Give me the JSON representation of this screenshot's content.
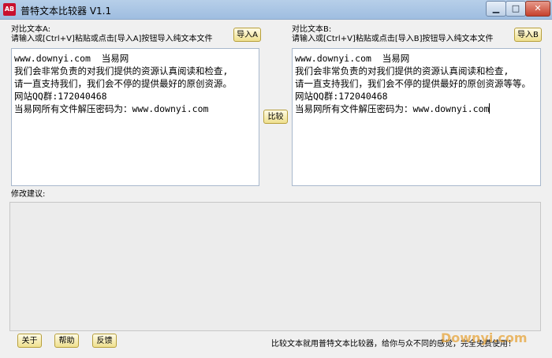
{
  "window": {
    "icon_text": "AB",
    "title": "普特文本比较器 V1.1",
    "min_glyph": "▁",
    "max_glyph": "□",
    "close_glyph": "✕"
  },
  "panel_a": {
    "title": "对比文本A:",
    "hint": "请输入或[Ctrl+V]粘贴或点击[导入A]按钮导入纯文本文件",
    "import_label": "导入A",
    "text": "www.downyi.com  当易网\n我们会非常负责的对我们提供的资源认真阅读和检查,\n请一直支持我们，我们会不停的提供最好的原创资源。\n网站QQ群:172040468\n当易网所有文件解压密码为：www.downyi.com"
  },
  "panel_b": {
    "title": "对比文本B:",
    "hint": "请输入或[Ctrl+V]粘贴或点击[导入B]按钮导入纯文本文件",
    "import_label": "导入B",
    "text": "www.downyi.com  当易网\n我们会非常负责的对我们提供的资源认真阅读和检查,\n请一直支持我们，我们会不停的提供最好的原创资源等等。\n网站QQ群:172040468\n当易网所有文件解压密码为：www.downyi.com"
  },
  "compare_label": "比较",
  "suggestion_label": "修改建议:",
  "footer": {
    "about": "关于",
    "help": "帮助",
    "feedback": "反馈",
    "slogan": "比较文本就用普特文本比较器，给你与众不同的感觉，完全免费使用！",
    "watermark": "Downyi.com"
  },
  "colors": {
    "accent": "#efe08e",
    "title_bar": "#b7cfe9",
    "watermark": "#e7a43a"
  }
}
